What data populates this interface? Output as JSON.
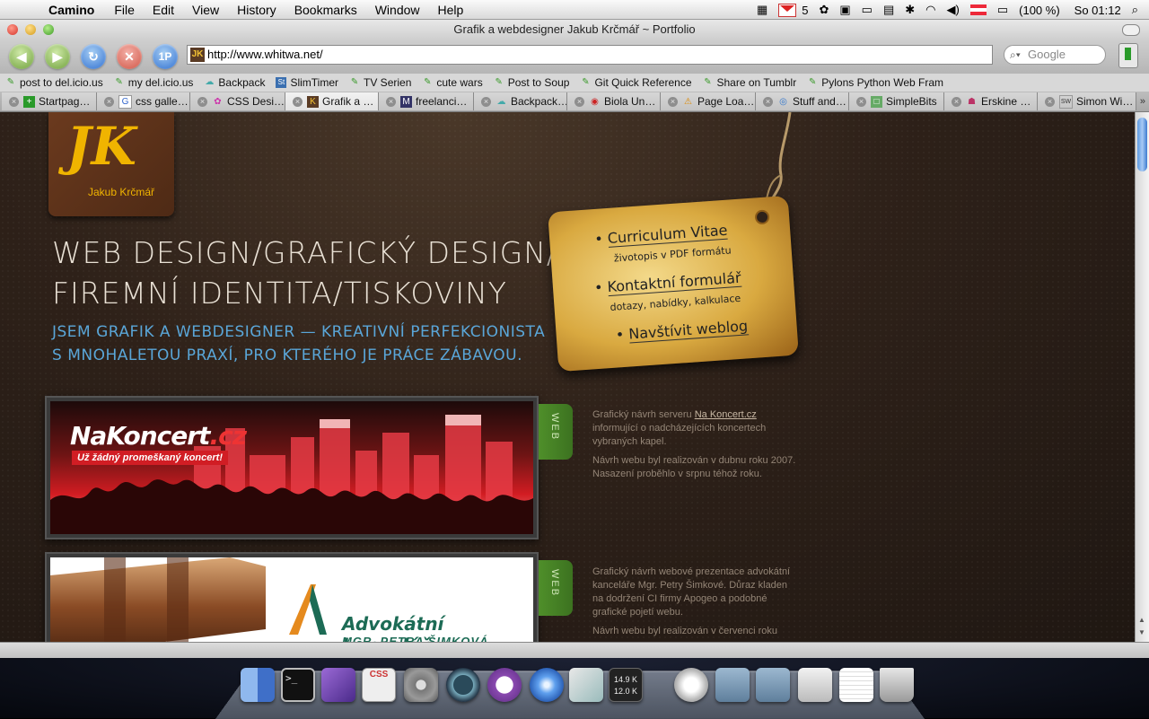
{
  "menubar": {
    "app": "Camino",
    "items": [
      "File",
      "Edit",
      "View",
      "History",
      "Bookmarks",
      "Window",
      "Help"
    ],
    "gmail_count": "5",
    "battery": "(100 %)",
    "clock": "So 01:12"
  },
  "window": {
    "title": "Grafik a webdesigner Jakub Krčmář ~ Portfolio"
  },
  "toolbar": {
    "url": "http://www.whitwa.net/",
    "search_placeholder": "Google"
  },
  "bookmarks": [
    "post to del.icio.us",
    "my del.icio.us",
    "Backpack",
    "SlimTimer",
    "TV Serien",
    "cute wars",
    "Post to Soup",
    "Git Quick Reference",
    "Share on Tumblr",
    "Pylons Python Web Fram"
  ],
  "tabs": [
    "Startpag…",
    "css galle…",
    "CSS Desi…",
    "Grafik a …",
    "freelanci…",
    "Backpack…",
    "Biola Un…",
    "Page Loa…",
    "Stuff and…",
    "SimpleBits",
    "Erskine …",
    "Simon Wi…"
  ],
  "page": {
    "logo_mono": "JK",
    "logo_name": "Jakub Krčmář",
    "headline_1": "WEB DESIGN/GRAFICKÝ DESIGN/",
    "headline_2": "FIREMNÍ IDENTITA/TISKOVINY",
    "sub_1": "JSEM GRAFIK A WEBDESIGNER — KREATIVNÍ PERFEKCIONISTA",
    "sub_2": "S MNOHALETOU PRAXÍ, PRO KTERÉHO JE PRÁCE ZÁBAVOU.",
    "tag": {
      "cv": "Curriculum Vitae",
      "cv_sub": "životopis v PDF formátu",
      "contact": "Kontaktní formulář",
      "contact_sub": "dotazy, nabídky, kalkulace",
      "blog": "Navštívit weblog"
    },
    "projects": [
      {
        "label": "WEB",
        "logo_main": "NaKoncert",
        "logo_tld": ".cz",
        "slogan": "Už žádný promeškaný koncert!",
        "desc_pre": "Grafický návrh serveru ",
        "desc_link": "Na Koncert.cz",
        "desc_post": " informující o nadcházejících koncertech vybraných kapel.",
        "desc_2": "Návrh webu byl realizován v dubnu roku 2007. Nasazení proběhlo v srpnu téhož roku."
      },
      {
        "label": "WEB",
        "title": "Advokátní kancelář",
        "subtitle": "MGR. PETRA ŠIMKOVÁ",
        "desc_1": "Grafický návrh webové prezentace advokátní kanceláře Mgr. Petry Šimkové. Důraz kladen na dodržení CI firmy Apogeo a podobné grafické pojetí webu.",
        "desc_2": "Návrh webu byl realizován v červenci roku"
      }
    ]
  },
  "dock": {
    "net_up": "14.9 K",
    "net_down": "12.0 K"
  }
}
